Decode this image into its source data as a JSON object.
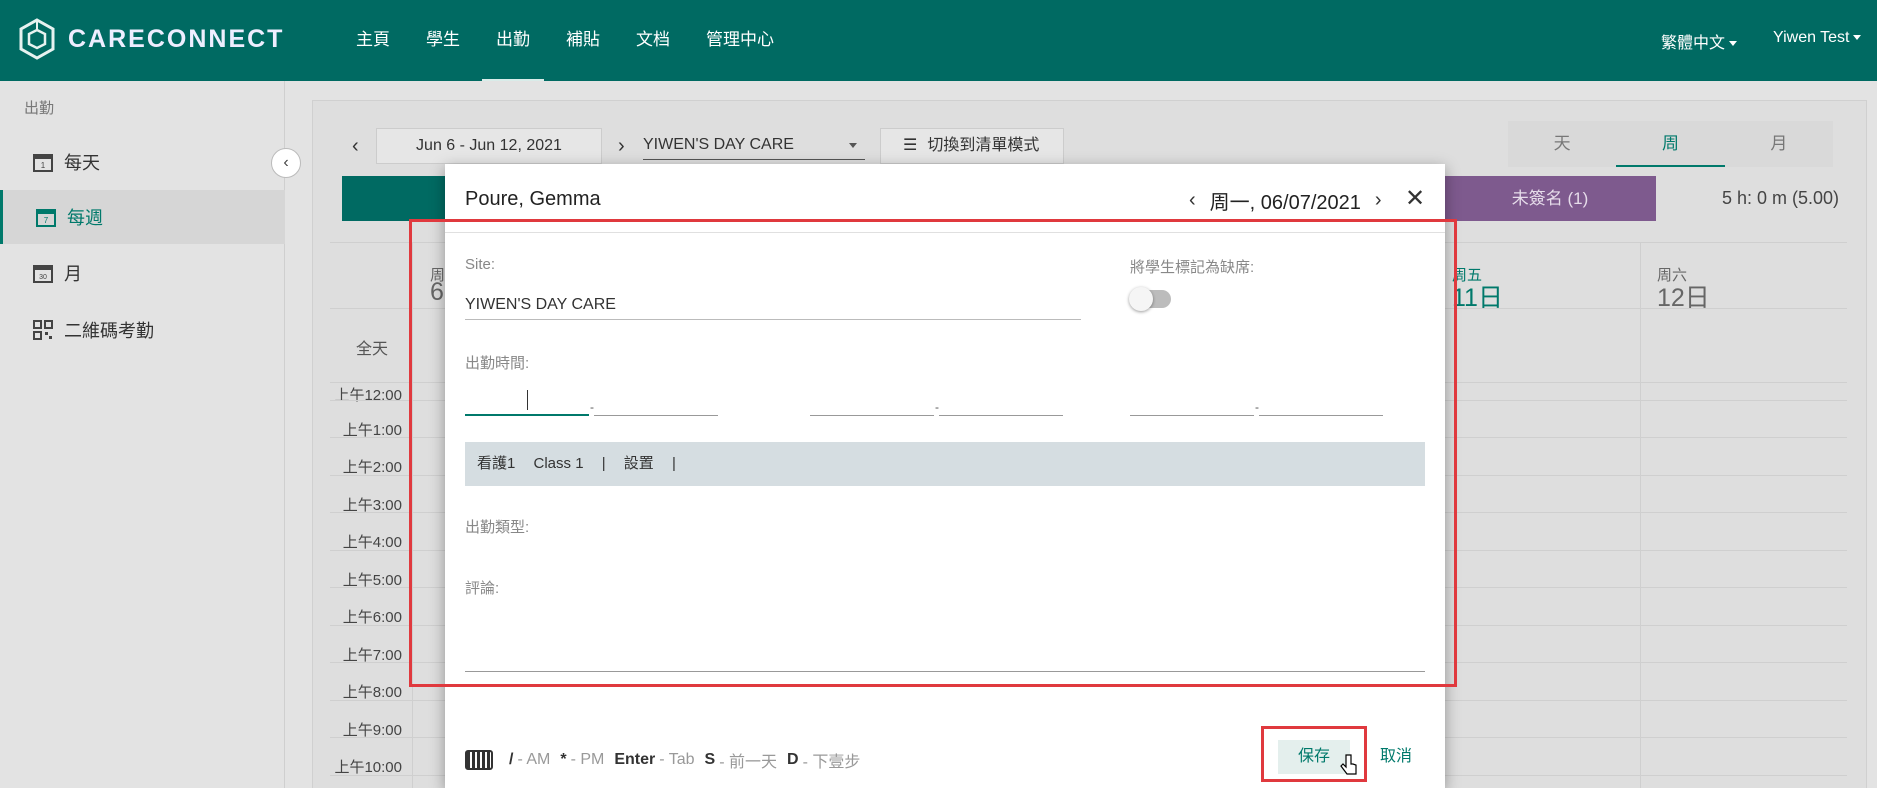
{
  "brand": {
    "name": "CARECONNECT"
  },
  "nav": {
    "items": [
      "主頁",
      "學生",
      "出勤",
      "補貼",
      "文档",
      "管理中心"
    ],
    "language": "繁體中文",
    "user": "Yiwen Test"
  },
  "sidebar": {
    "title": "出勤",
    "items": [
      {
        "label": "每天",
        "icon_num": "1"
      },
      {
        "label": "每週",
        "icon_num": "7"
      },
      {
        "label": "月",
        "icon_num": "30"
      },
      {
        "label": "二維碼考勤"
      }
    ]
  },
  "toolbar": {
    "date_range": "Jun 6 - Jun 12, 2021",
    "site": "YIWEN'S DAY CARE",
    "list_mode": "切換到清單模式",
    "views": [
      "天",
      "周",
      "月"
    ],
    "unsigned": "未簽名 (1)",
    "hours": "5 h: 0 m (5.00)"
  },
  "calendar": {
    "allday": "全天",
    "left_head": "周",
    "left_num": "6",
    "thu_head": "周五",
    "thu_num": "11日",
    "sat_head": "周六",
    "sat_num": "12日",
    "times": [
      "上午12:00",
      "上午1:00",
      "上午2:00",
      "上午3:00",
      "上午4:00",
      "上午5:00",
      "上午6:00",
      "上午7:00",
      "上午8:00",
      "上午9:00",
      "上午10:00"
    ]
  },
  "modal": {
    "title": "Poure, Gemma",
    "date": "周一, 06/07/2021",
    "site_label": "Site:",
    "site_value": "YIWEN'S DAY CARE",
    "absent_label": "將學生標記為缺席:",
    "time_label": "出勤時間:",
    "class_bar": {
      "a": "看護1",
      "b": "Class 1",
      "sep": "|",
      "c": "設置"
    },
    "type_label": "出勤類型:",
    "comment_label": "評論:",
    "hints": [
      {
        "key": "/",
        "text": "- AM"
      },
      {
        "key": "*",
        "text": "- PM"
      },
      {
        "key": "Enter",
        "text": "- Tab"
      },
      {
        "key": "S",
        "text": "- 前一天"
      },
      {
        "key": "D",
        "text": "- 下壹步"
      }
    ],
    "save": "保存",
    "cancel": "取消"
  }
}
